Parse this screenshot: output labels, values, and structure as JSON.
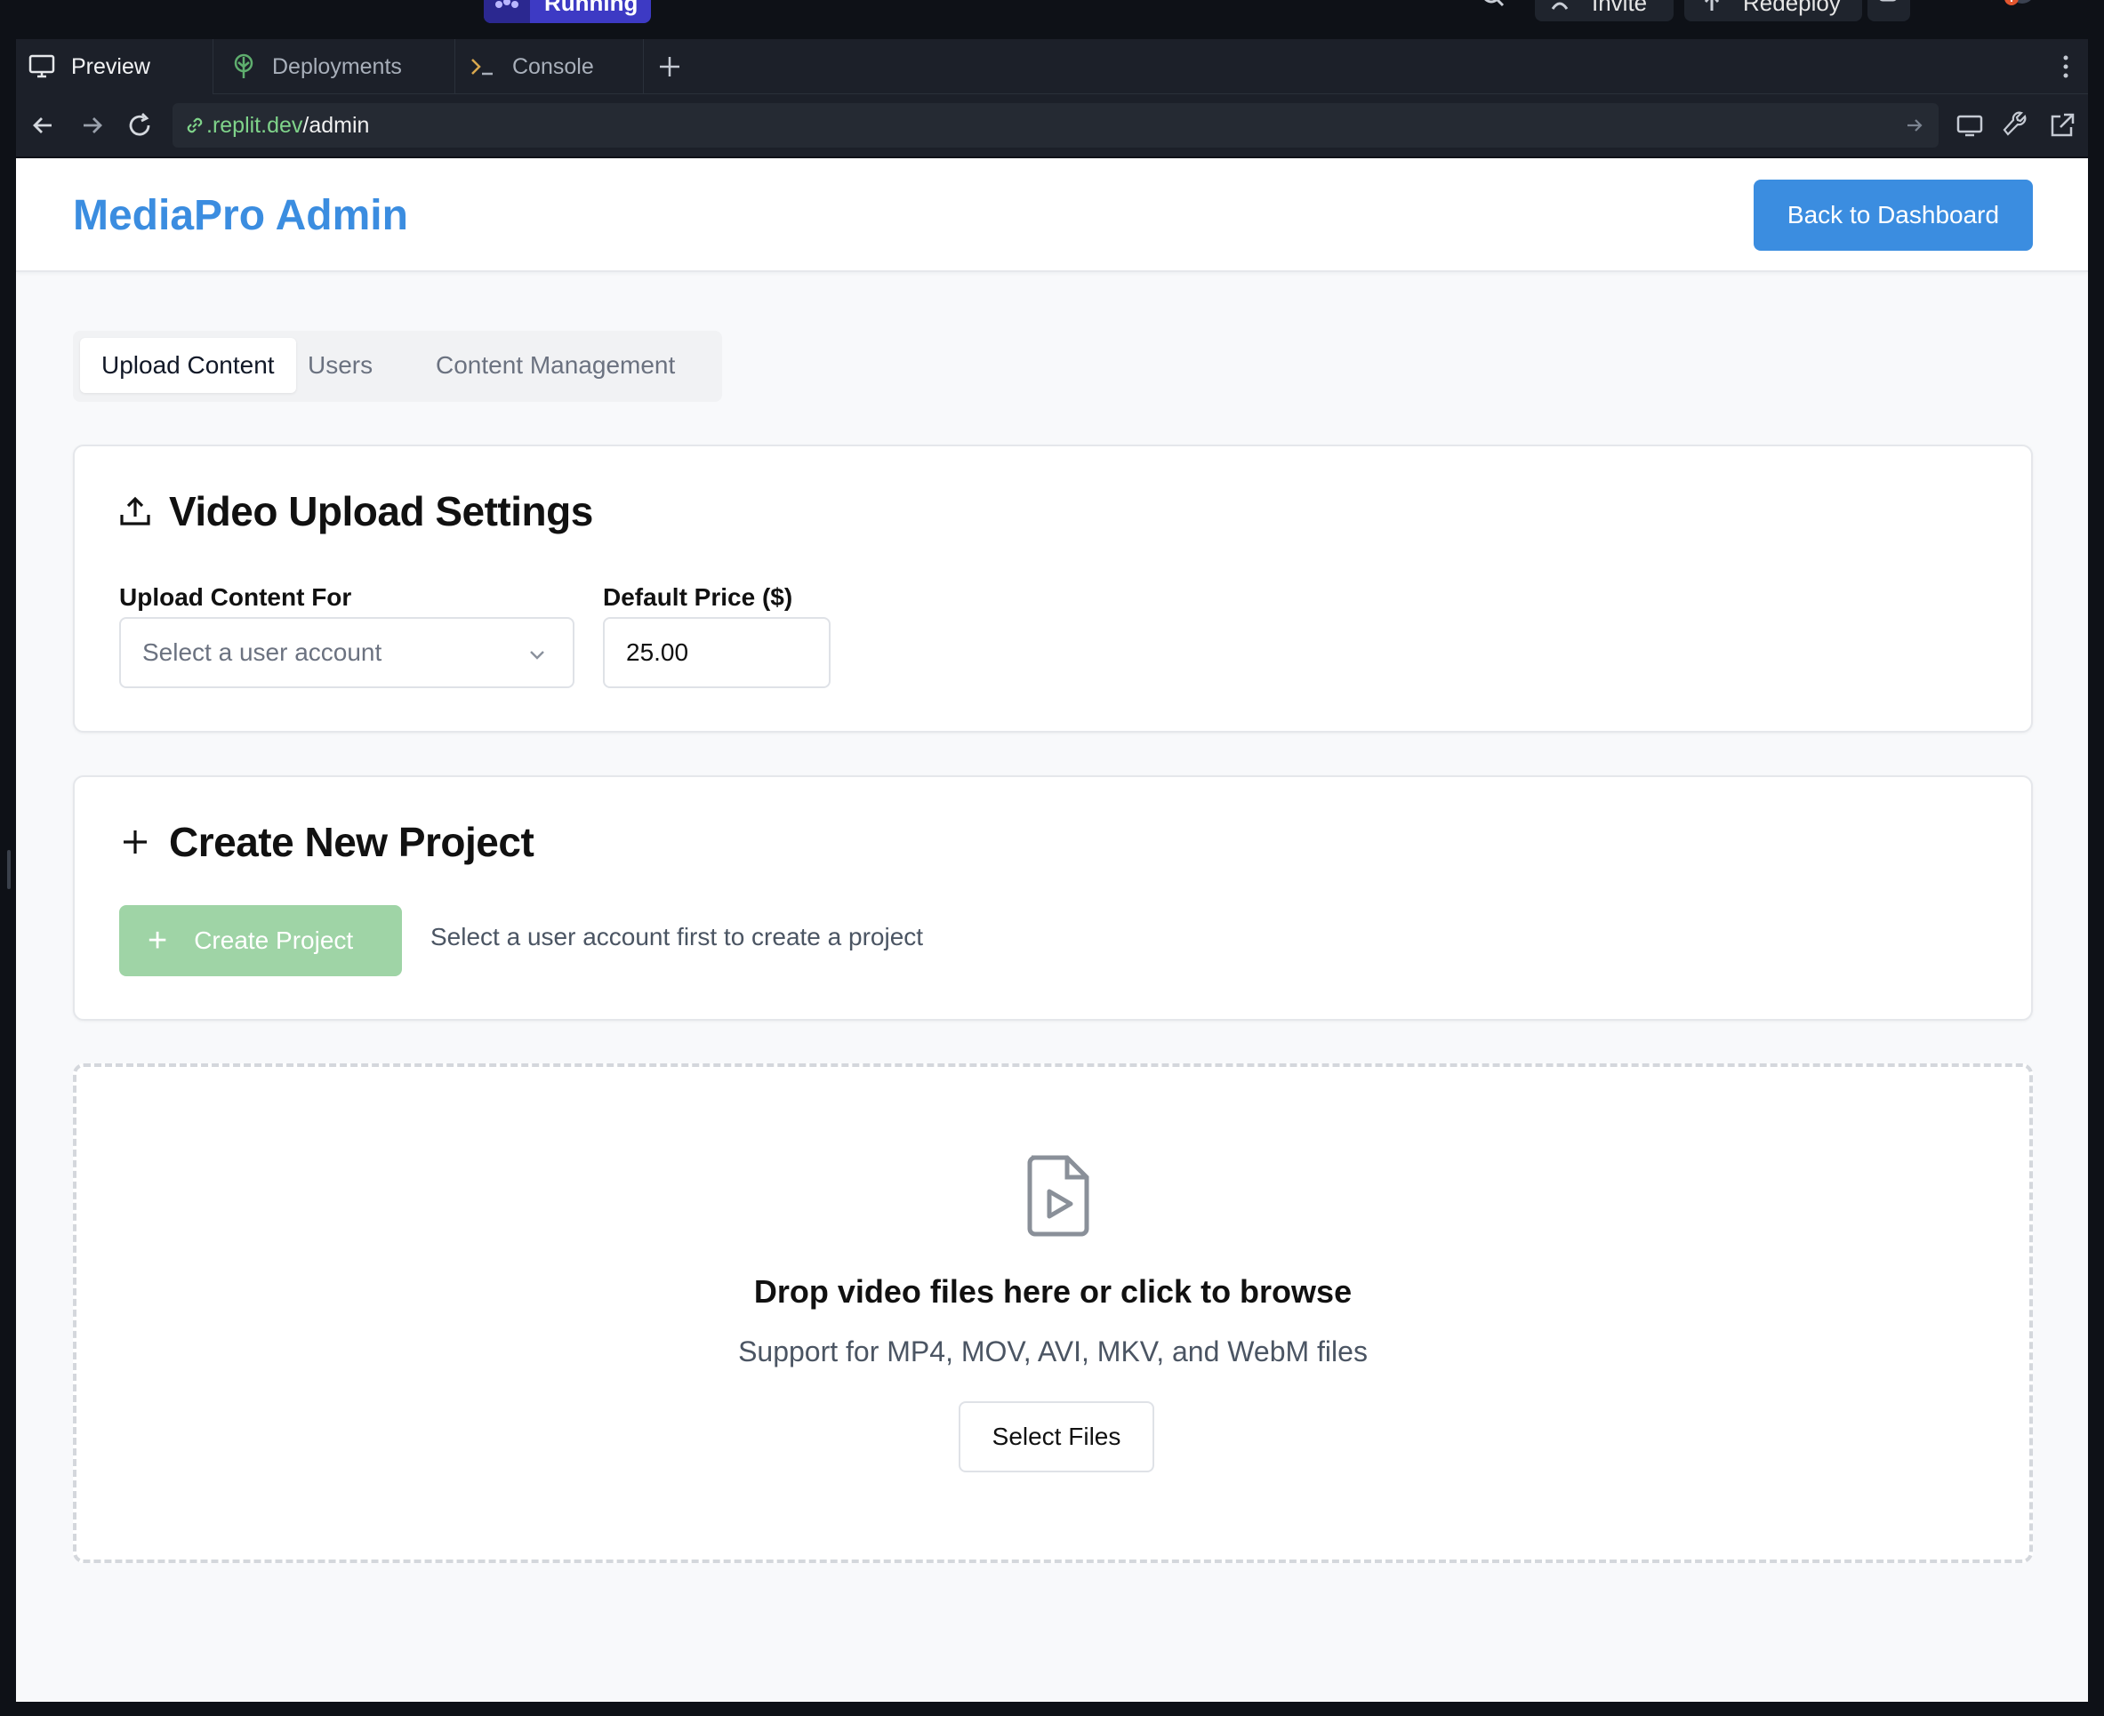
{
  "replit": {
    "status": "Running",
    "invite_label": "Invite",
    "redeploy_label": "Redeploy"
  },
  "tabs": [
    {
      "label": "Preview",
      "icon": "monitor-icon"
    },
    {
      "label": "Deployments",
      "icon": "deploy-icon"
    },
    {
      "label": "Console",
      "icon": "terminal-icon"
    }
  ],
  "address": {
    "domain": ".replit.dev",
    "path": "/admin"
  },
  "app": {
    "brand": "MediaPro Admin",
    "back_label": "Back to Dashboard",
    "accent": "#3b8de0"
  },
  "page_tabs": [
    {
      "label": "Upload Content",
      "active": true
    },
    {
      "label": "Users",
      "active": false
    },
    {
      "label": "Content Management",
      "active": false
    }
  ],
  "upload_settings": {
    "title": "Video Upload Settings",
    "user_label": "Upload Content For",
    "user_placeholder": "Select a user account",
    "price_label": "Default Price ($)",
    "price_value": "25.00"
  },
  "project": {
    "title": "Create New Project",
    "button_label": "Create Project",
    "hint": "Select a user account first to create a project"
  },
  "dropzone": {
    "title": "Drop video files here or click to browse",
    "subtitle": "Support for MP4, MOV, AVI, MKV, and WebM files",
    "button_label": "Select Files"
  }
}
